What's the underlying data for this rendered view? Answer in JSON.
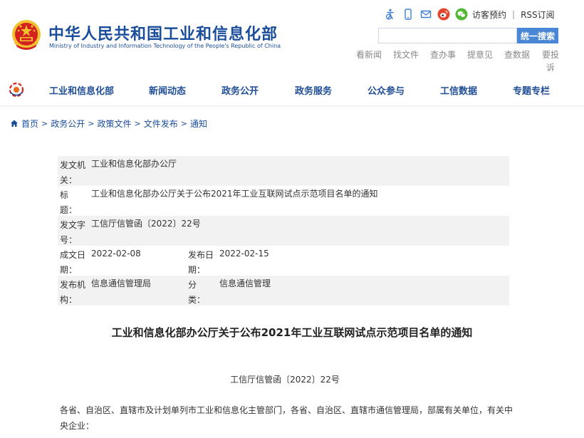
{
  "header": {
    "title_cn": "中华人民共和国工业和信息化部",
    "title_en": "Ministry of Industry and Information Technology of the People's Republic of China",
    "visit_link": "访客预约",
    "separator": "|",
    "rss_link": "RSS订阅",
    "search": {
      "placeholder": "",
      "button_label": "统一搜索"
    },
    "quick_links": [
      "看新闻",
      "找文件",
      "查办事",
      "提意见",
      "查数据"
    ],
    "quick_link_last": "要投诉",
    "icons": [
      "accessibility-icon",
      "mobile-icon",
      "mail-icon",
      "weibo-icon",
      "wechat-icon"
    ]
  },
  "nav": {
    "items": [
      "工业和信息化部",
      "新闻动态",
      "政务公开",
      "政务服务",
      "公众参与",
      "工信数据",
      "专题专栏"
    ]
  },
  "breadcrumb": {
    "items": [
      "首页",
      "政务公开",
      "政策文件",
      "文件发布",
      "通知"
    ],
    "separator": ">"
  },
  "meta": {
    "issuer_label": "发文机关：",
    "issuer": "工业和信息化部办公厅",
    "title_label": "标　　题：",
    "title": "工业和信息化部办公厅关于公布2021年工业互联网试点示范项目名单的通知",
    "doc_no_label": "发文字号：",
    "doc_no": "工信厅信管函〔2022〕22号",
    "created_label": "成文日期：",
    "created": "2022-02-08",
    "published_label": "发布日期：",
    "published": "2022-02-15",
    "agency_label": "发布机构：",
    "agency": "信息通信管理局",
    "category_label": "分　　类：",
    "category": "信息通信管理"
  },
  "article": {
    "title": "工业和信息化部办公厅关于公布2021年工业互联网试点示范项目名单的通知",
    "doc_no": "工信厅信管函〔2022〕22号",
    "body": "各省、自治区、直辖市及计划单列市工业和信息化主管部门，各省、自治区、直辖市通信管理局，部属有关单位，有关中央企业："
  },
  "colors": {
    "brand_blue": "#1a4d9c",
    "nav_blue": "#1f4e96",
    "search_button": "#4a86d6",
    "emblem_red": "#d4231f",
    "emblem_gold": "#f2c230"
  }
}
